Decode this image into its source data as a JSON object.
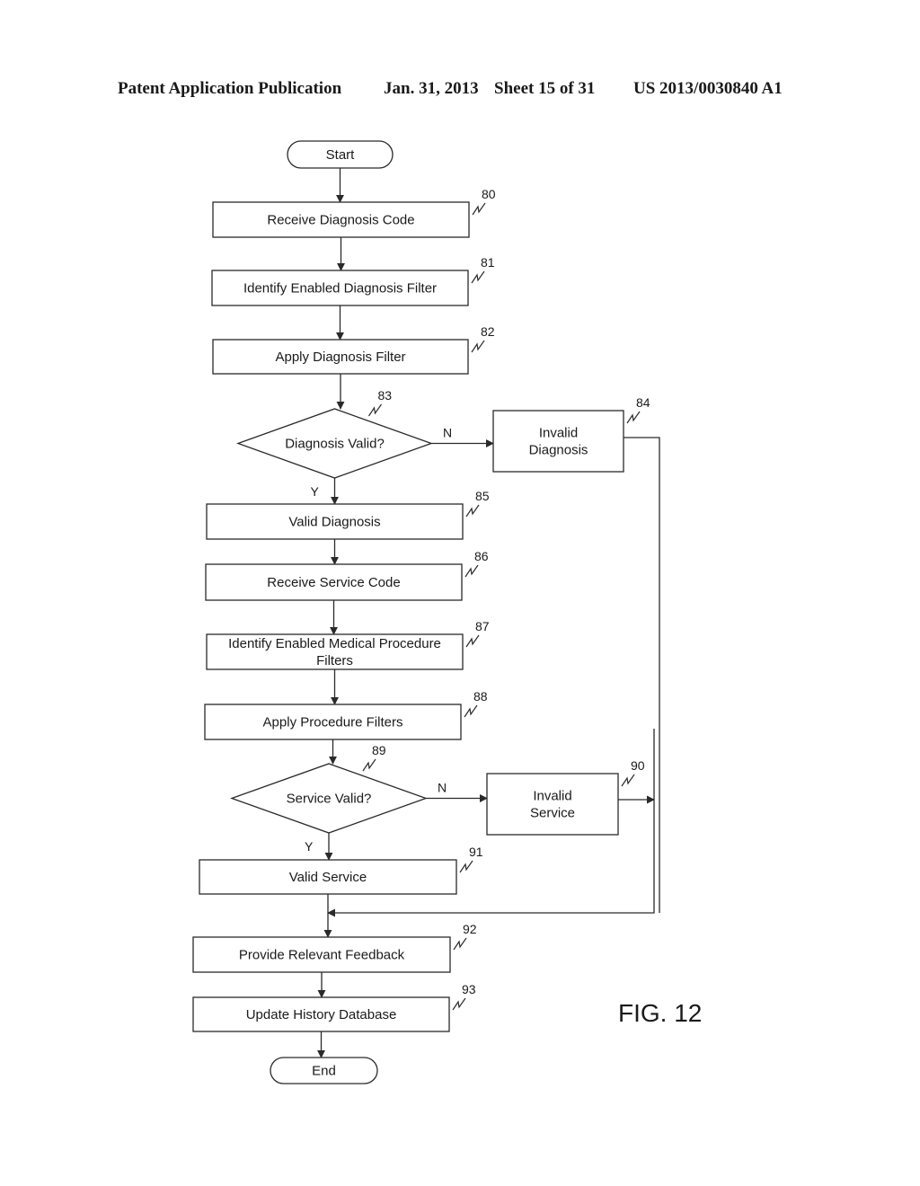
{
  "header": {
    "publication": "Patent Application Publication",
    "date": "Jan. 31, 2013",
    "sheet": "Sheet 15 of 31",
    "number": "US 2013/0030840 A1"
  },
  "figure_label": "FIG. 12",
  "nodes": [
    {
      "id": "start",
      "type": "terminal",
      "lines": [
        "Start"
      ],
      "ref": ""
    },
    {
      "id": "n80",
      "type": "process",
      "lines": [
        "Receive Diagnosis Code"
      ],
      "ref": "80"
    },
    {
      "id": "n81",
      "type": "process",
      "lines": [
        "Identify Enabled Diagnosis Filter"
      ],
      "ref": "81"
    },
    {
      "id": "n82",
      "type": "process",
      "lines": [
        "Apply Diagnosis Filter"
      ],
      "ref": "82"
    },
    {
      "id": "n83",
      "type": "decision",
      "lines": [
        "Diagnosis Valid?"
      ],
      "ref": "83"
    },
    {
      "id": "n84",
      "type": "process",
      "lines": [
        "Invalid",
        "Diagnosis"
      ],
      "ref": "84"
    },
    {
      "id": "n85",
      "type": "process",
      "lines": [
        "Valid Diagnosis"
      ],
      "ref": "85"
    },
    {
      "id": "n86",
      "type": "process",
      "lines": [
        "Receive Service Code"
      ],
      "ref": "86"
    },
    {
      "id": "n87",
      "type": "process",
      "lines": [
        "Identify Enabled Medical Procedure",
        "Filters"
      ],
      "ref": "87"
    },
    {
      "id": "n88",
      "type": "process",
      "lines": [
        "Apply Procedure Filters"
      ],
      "ref": "88"
    },
    {
      "id": "n89",
      "type": "decision",
      "lines": [
        "Service Valid?"
      ],
      "ref": "89"
    },
    {
      "id": "n90",
      "type": "process",
      "lines": [
        "Invalid",
        "Service"
      ],
      "ref": "90"
    },
    {
      "id": "n91",
      "type": "process",
      "lines": [
        "Valid Service"
      ],
      "ref": "91"
    },
    {
      "id": "n92",
      "type": "process",
      "lines": [
        "Provide Relevant Feedback"
      ],
      "ref": "92"
    },
    {
      "id": "n93",
      "type": "process",
      "lines": [
        "Update History Database"
      ],
      "ref": "93"
    },
    {
      "id": "end",
      "type": "terminal",
      "lines": [
        "End"
      ],
      "ref": ""
    }
  ],
  "edges": [
    {
      "from": "start",
      "to": "n80",
      "label": ""
    },
    {
      "from": "n80",
      "to": "n81",
      "label": ""
    },
    {
      "from": "n81",
      "to": "n82",
      "label": ""
    },
    {
      "from": "n82",
      "to": "n83",
      "label": ""
    },
    {
      "from": "n83",
      "to": "n84",
      "label": "N"
    },
    {
      "from": "n83",
      "to": "n85",
      "label": "Y"
    },
    {
      "from": "n85",
      "to": "n86",
      "label": ""
    },
    {
      "from": "n86",
      "to": "n87",
      "label": ""
    },
    {
      "from": "n87",
      "to": "n88",
      "label": ""
    },
    {
      "from": "n88",
      "to": "n89",
      "label": ""
    },
    {
      "from": "n89",
      "to": "n90",
      "label": "N"
    },
    {
      "from": "n89",
      "to": "n91",
      "label": "Y"
    },
    {
      "from": "n84",
      "to": "n92",
      "label": ""
    },
    {
      "from": "n90",
      "to": "n92",
      "label": ""
    },
    {
      "from": "n91",
      "to": "n92",
      "label": ""
    },
    {
      "from": "n92",
      "to": "n93",
      "label": ""
    },
    {
      "from": "n93",
      "to": "end",
      "label": ""
    }
  ]
}
